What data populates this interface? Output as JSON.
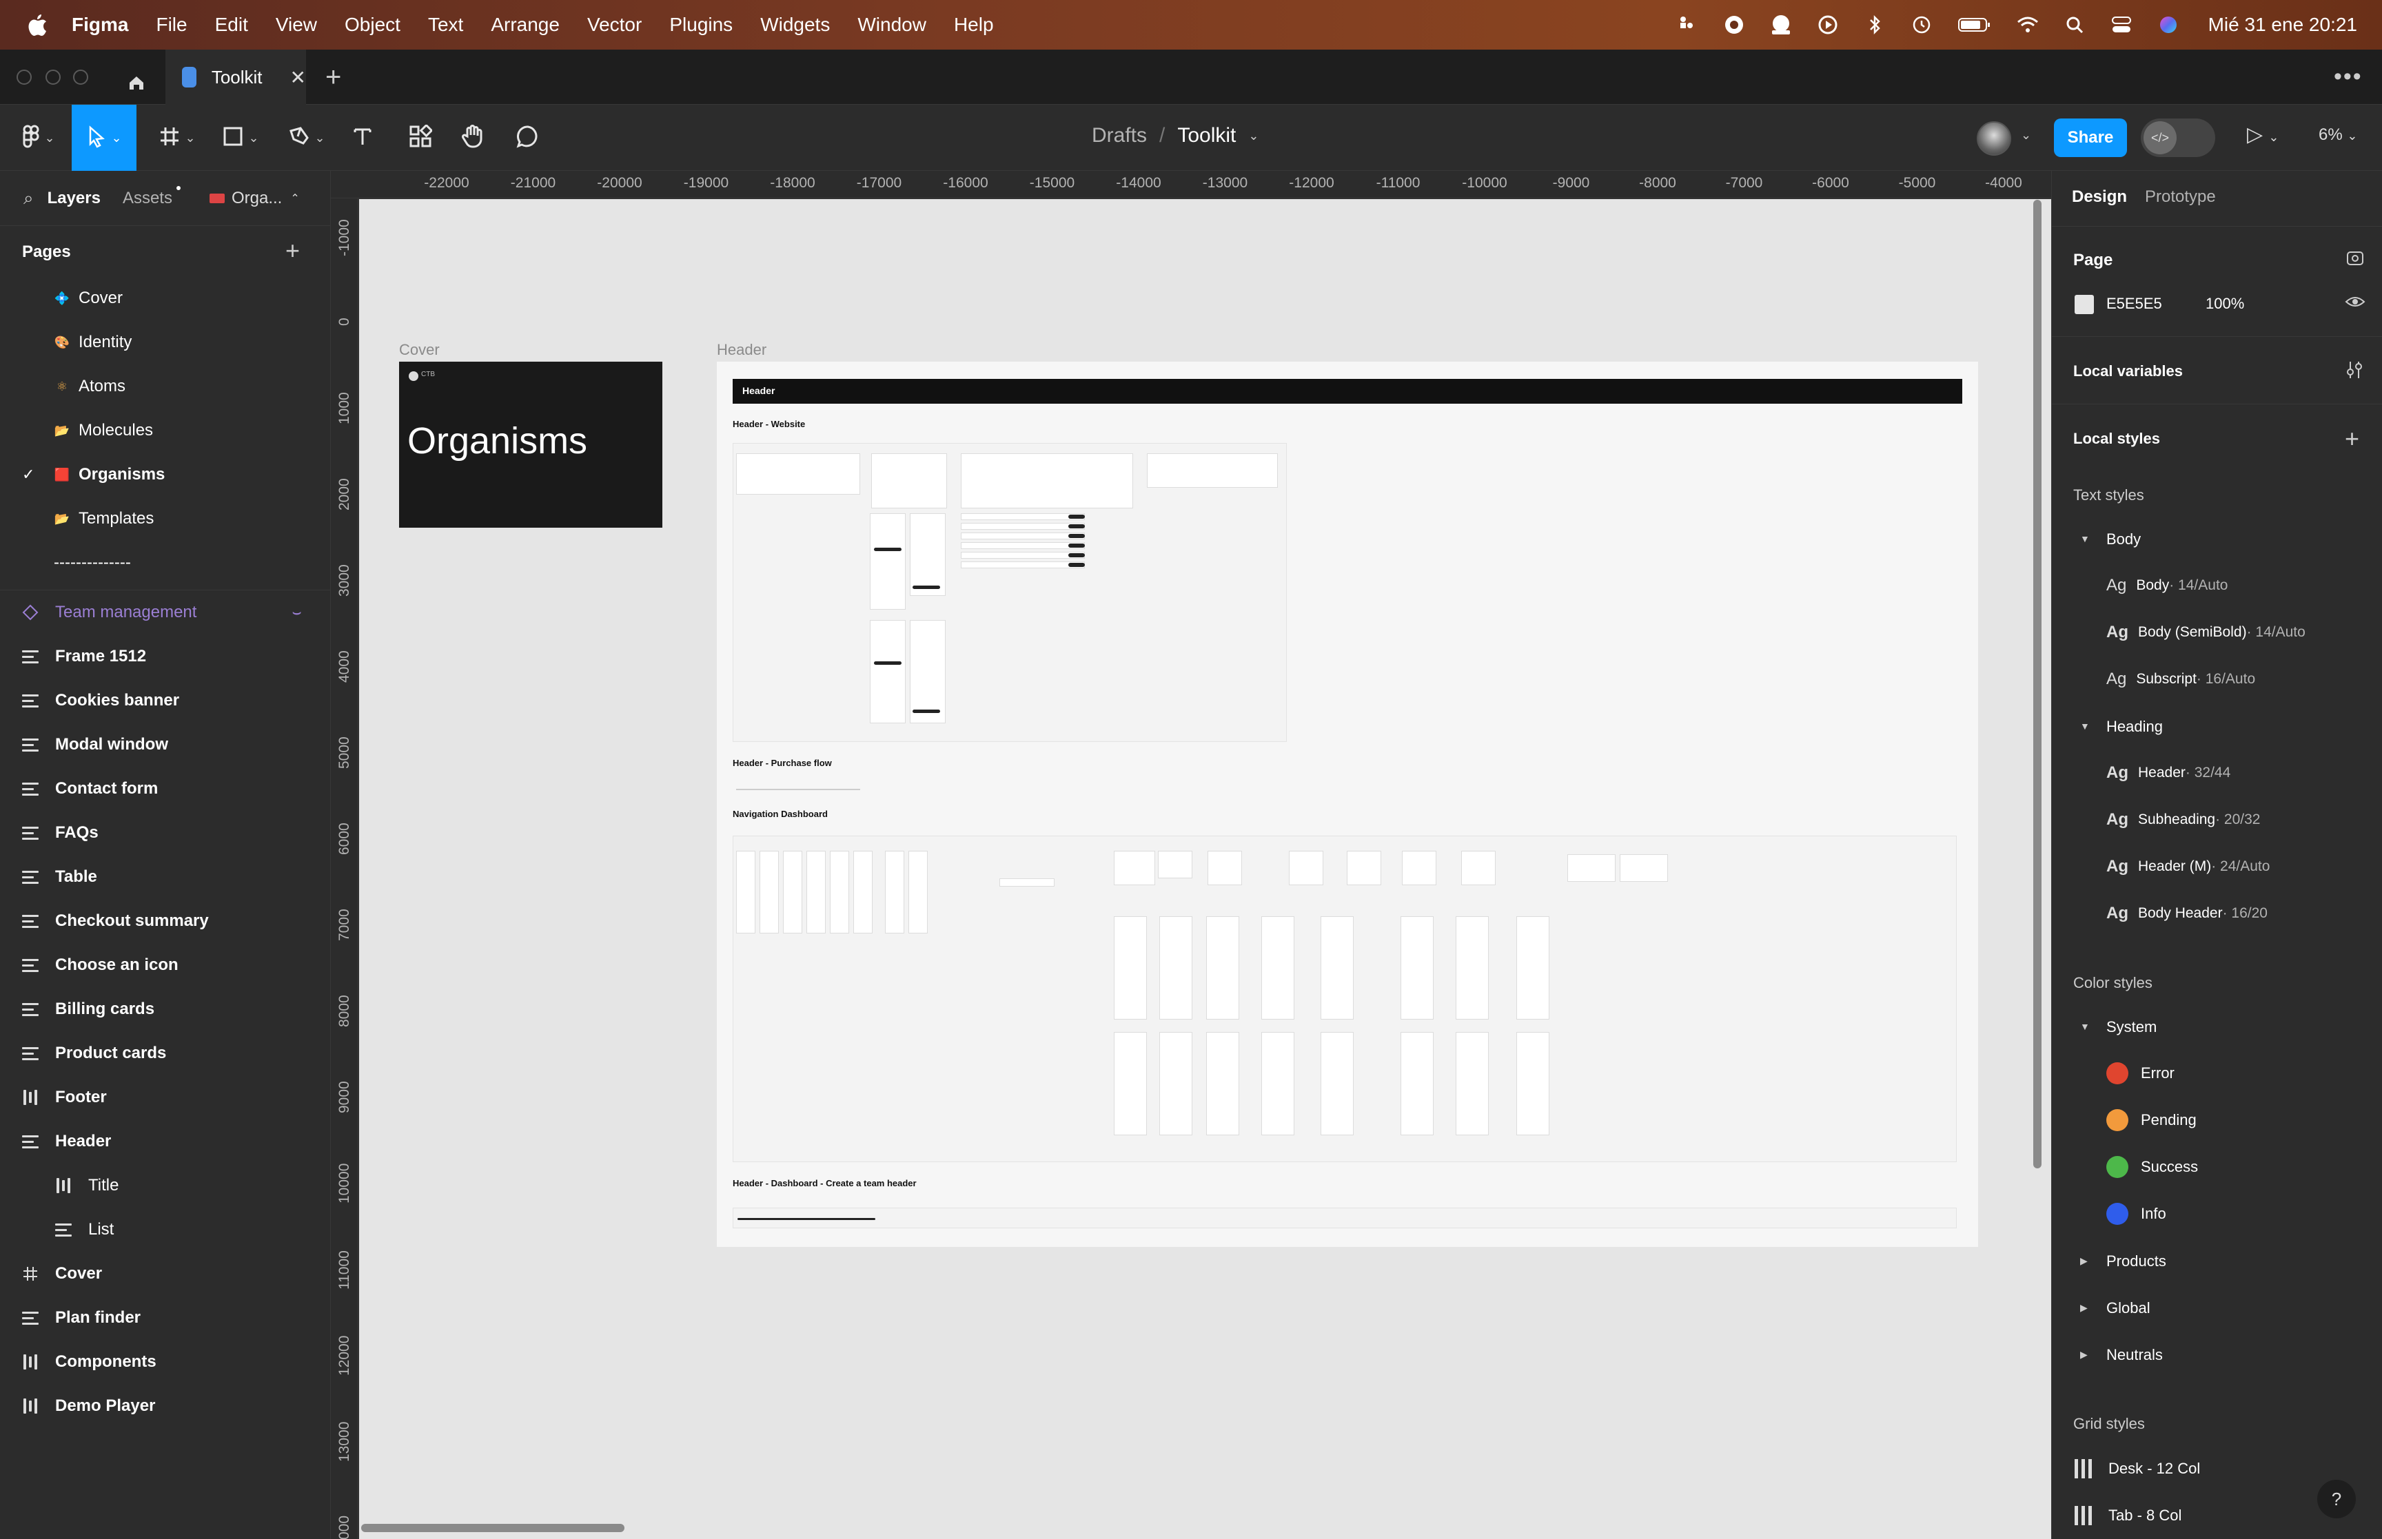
{
  "menubar": {
    "app": "Figma",
    "items": [
      "File",
      "Edit",
      "View",
      "Object",
      "Text",
      "Arrange",
      "Vector",
      "Plugins",
      "Widgets",
      "Window",
      "Help"
    ],
    "status_icons": [
      "figma-mirror-icon",
      "creative-cloud-icon",
      "screen-record-icon",
      "play-circle-icon",
      "bluetooth-icon",
      "time-machine-icon",
      "battery-icon",
      "wifi-icon",
      "spotlight-search-icon",
      "control-center-icon",
      "siri-icon"
    ],
    "clock": "Mié 31 ene 20:21"
  },
  "tabbar": {
    "file_tab": "Toolkit",
    "new_tab": "+",
    "more": "•••"
  },
  "toolbar": {
    "breadcrumb_parent": "Drafts",
    "breadcrumb_sep": "/",
    "file_name": "Toolkit",
    "share_label": "Share",
    "zoom": "6%"
  },
  "left_panel": {
    "tabs": {
      "layers": "Layers",
      "assets": "Assets",
      "page_selector": "Orga..."
    },
    "pages_title": "Pages",
    "pages": [
      {
        "label": "Cover",
        "emoji": "💠",
        "selected": false
      },
      {
        "label": "Identity",
        "emoji": "🎨",
        "selected": false
      },
      {
        "label": "Atoms",
        "emoji": "⚛",
        "selected": false
      },
      {
        "label": "Molecules",
        "emoji": "📂",
        "selected": false
      },
      {
        "label": "Organisms",
        "emoji": "🟥",
        "selected": true
      },
      {
        "label": "Templates",
        "emoji": "📂",
        "selected": false
      },
      {
        "label": "--------------",
        "emoji": "",
        "selected": false
      }
    ],
    "layers": [
      {
        "label": "Team management",
        "type": "component"
      },
      {
        "label": "Frame 1512",
        "type": "auto-layout"
      },
      {
        "label": "Cookies banner",
        "type": "auto-layout"
      },
      {
        "label": "Modal window",
        "type": "auto-layout"
      },
      {
        "label": "Contact form",
        "type": "auto-layout"
      },
      {
        "label": "FAQs",
        "type": "auto-layout"
      },
      {
        "label": "Table",
        "type": "auto-layout"
      },
      {
        "label": "Checkout summary",
        "type": "auto-layout"
      },
      {
        "label": "Choose an icon",
        "type": "auto-layout"
      },
      {
        "label": "Billing cards",
        "type": "auto-layout"
      },
      {
        "label": "Product cards",
        "type": "auto-layout"
      },
      {
        "label": "Footer",
        "type": "auto-layout-horizontal"
      },
      {
        "label": "Header",
        "type": "auto-layout"
      },
      {
        "label": "Title",
        "type": "auto-layout-horizontal",
        "child": true
      },
      {
        "label": "List",
        "type": "auto-layout",
        "child": true
      },
      {
        "label": "Cover",
        "type": "frame"
      },
      {
        "label": "Plan finder",
        "type": "auto-layout"
      },
      {
        "label": "Components",
        "type": "auto-layout-horizontal"
      },
      {
        "label": "Demo Player",
        "type": "auto-layout-horizontal"
      }
    ]
  },
  "rulers": {
    "top": [
      "-22000",
      "-21000",
      "-20000",
      "-19000",
      "-18000",
      "-17000",
      "-16000",
      "-15000",
      "-14000",
      "-13000",
      "-12000",
      "-11000",
      "-10000",
      "-9000",
      "-8000",
      "-7000",
      "-6000",
      "-5000",
      "-4000"
    ],
    "left": [
      "-1000",
      "0",
      "1000",
      "2000",
      "3000",
      "4000",
      "5000",
      "6000",
      "7000",
      "8000",
      "9000",
      "10000",
      "11000",
      "12000",
      "13000",
      "000"
    ]
  },
  "canvas": {
    "background": "#E5E5E5",
    "frames": {
      "cover": {
        "label": "Cover",
        "title": "Organisms",
        "badge": "CTB"
      },
      "header": {
        "label": "Header",
        "bar_title": "Header",
        "sections": [
          "Header - Website",
          "Header - Purchase flow",
          "Navigation Dashboard",
          "Header - Dashboard - Create a team header"
        ]
      }
    }
  },
  "right_panel": {
    "tabs": {
      "design": "Design",
      "prototype": "Prototype"
    },
    "page": {
      "title": "Page",
      "color_hex": "E5E5E5",
      "opacity": "100%"
    },
    "local_variables": "Local variables",
    "local_styles": "Local styles",
    "text_styles": {
      "title": "Text styles",
      "groups": [
        {
          "name": "Body",
          "items": [
            {
              "name": "Body",
              "meta": " · 14/Auto"
            },
            {
              "name": "Body (SemiBold)",
              "meta": " · 14/Auto"
            },
            {
              "name": "Subscript",
              "meta": " · 16/Auto"
            }
          ]
        },
        {
          "name": "Heading",
          "items": [
            {
              "name": "Header",
              "meta": " · 32/44"
            },
            {
              "name": "Subheading",
              "meta": " · 20/32"
            },
            {
              "name": "Header (M)",
              "meta": " · 24/Auto"
            },
            {
              "name": "Body Header",
              "meta": " · 16/20"
            }
          ]
        }
      ]
    },
    "color_styles": {
      "title": "Color styles",
      "system_group": "System",
      "system": [
        {
          "name": "Error",
          "color": "#E0452F"
        },
        {
          "name": "Pending",
          "color": "#F29A3C"
        },
        {
          "name": "Success",
          "color": "#4DB84A"
        },
        {
          "name": "Info",
          "color": "#2F5DEB"
        }
      ],
      "collapsed_groups": [
        "Products",
        "Global",
        "Neutrals"
      ]
    },
    "grid_styles": {
      "title": "Grid styles",
      "items": [
        "Desk - 12 Col",
        "Tab - 8 Col"
      ]
    },
    "help": "?"
  },
  "colors": {
    "accent": "#0D99FF",
    "panel_bg": "#2C2C2C",
    "component_purple": "#9B7FD4"
  }
}
